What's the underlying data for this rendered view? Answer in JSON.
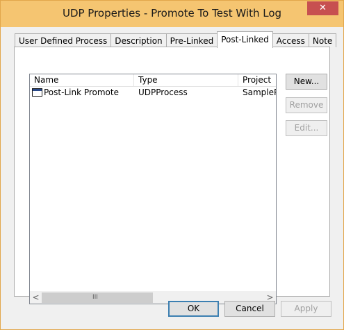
{
  "window": {
    "title": "UDP Properties - Promote To Test With Log",
    "close_glyph": "✕"
  },
  "tabs": [
    {
      "label": "User Defined Process",
      "active": false
    },
    {
      "label": "Description",
      "active": false
    },
    {
      "label": "Pre-Linked",
      "active": false
    },
    {
      "label": "Post-Linked",
      "active": true
    },
    {
      "label": "Access",
      "active": false
    },
    {
      "label": "Note",
      "active": false
    }
  ],
  "list": {
    "columns": [
      "Name",
      "Type",
      "Project"
    ],
    "rows": [
      {
        "name": "Post-Link Promote",
        "type": "UDPProcess",
        "project": "SamplePr"
      }
    ]
  },
  "side_buttons": {
    "new": "New...",
    "remove": "Remove",
    "edit": "Edit..."
  },
  "scrollbar": {
    "left_arrow": "<",
    "right_arrow": ">",
    "grip": "III"
  },
  "footer": {
    "ok": "OK",
    "cancel": "Cancel",
    "apply": "Apply"
  }
}
